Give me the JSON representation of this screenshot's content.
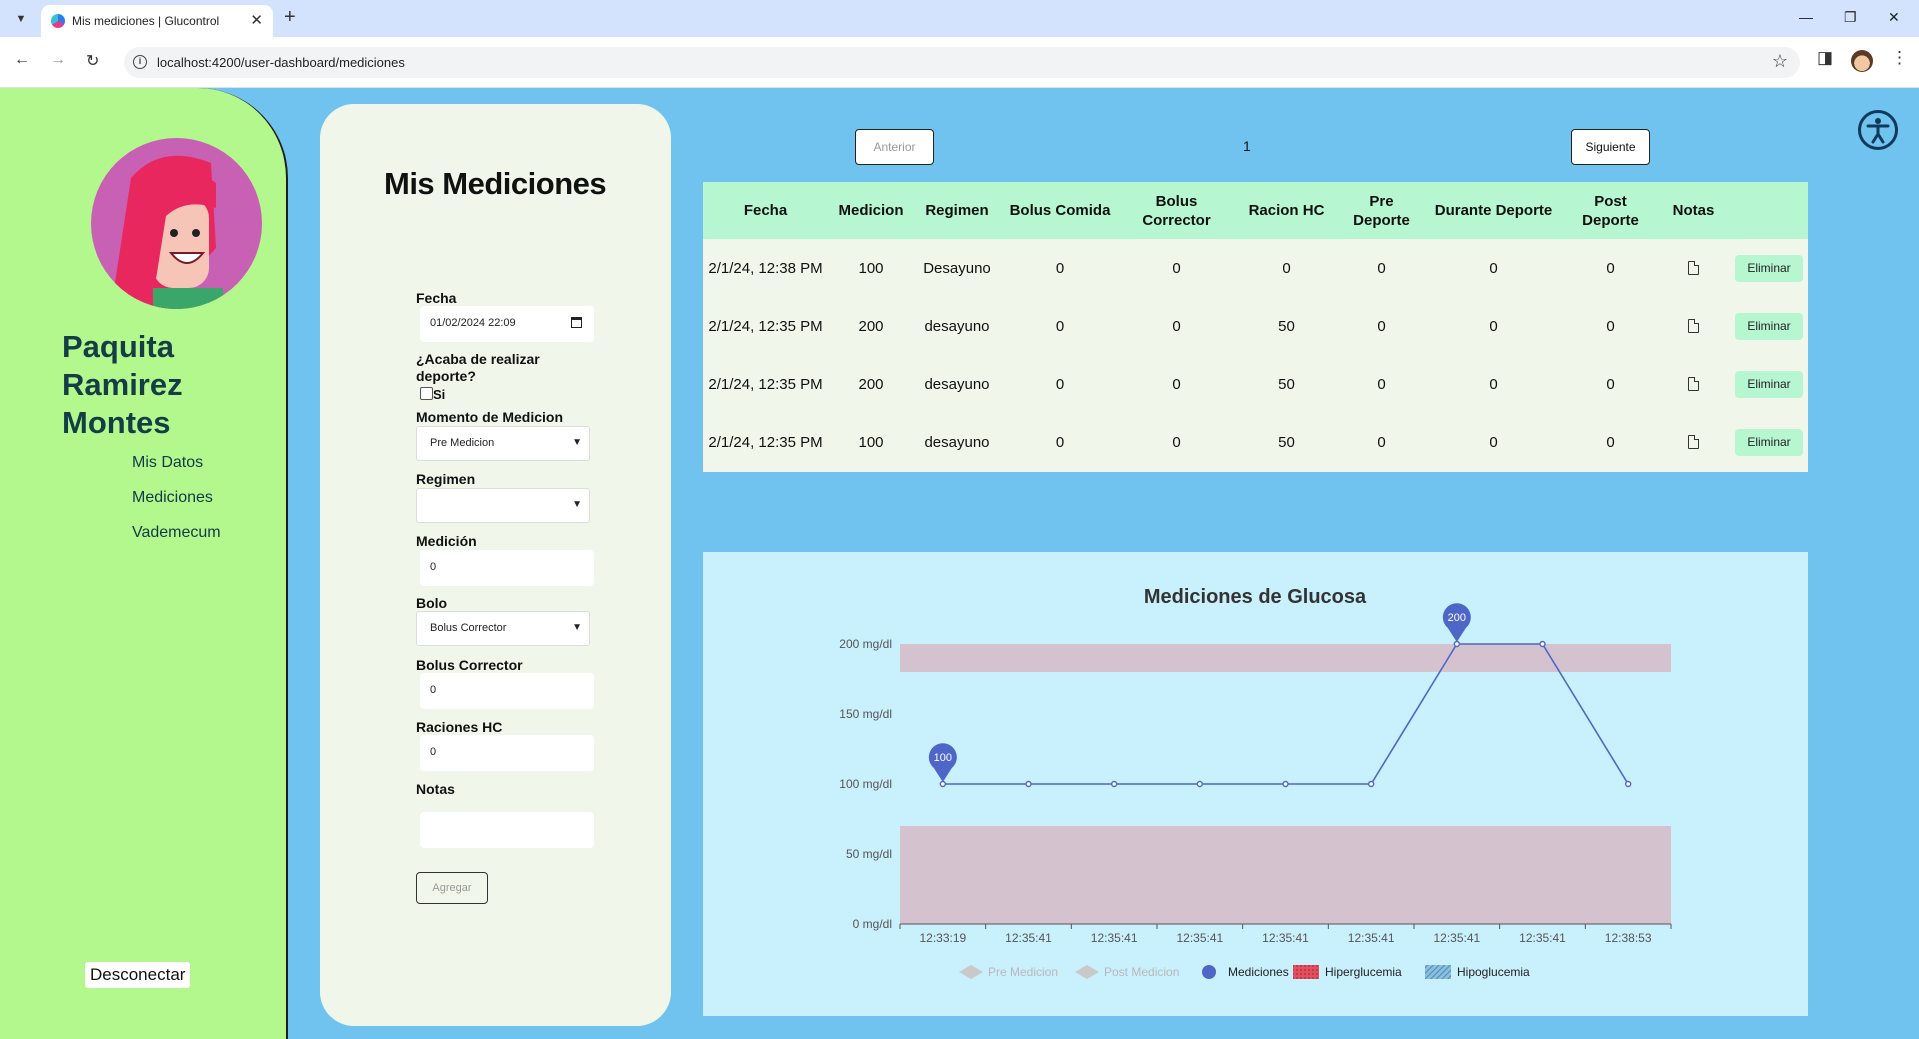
{
  "browser": {
    "tab_title": "Mis mediciones | Glucontrol",
    "url": "localhost:4200/user-dashboard/mediciones"
  },
  "sidebar": {
    "name": "Paquita Ramirez Montes",
    "links": [
      "Mis Datos",
      "Mediciones",
      "Vademecum"
    ],
    "logout_label": "Desconectar"
  },
  "form": {
    "title": "Mis Mediciones",
    "fecha_label": "Fecha",
    "fecha_value": "01/02/2024 22:09",
    "sport_question": "¿Acaba de realizar deporte?",
    "sport_option": "Si",
    "momento_label": "Momento de Medicion",
    "momento_value": "Pre Medicion",
    "regimen_label": "Regimen",
    "regimen_value": "",
    "medicion_label": "Medición",
    "medicion_value": "0",
    "bolo_label": "Bolo",
    "bolo_value": "Bolus Corrector",
    "bolus_corrector_label": "Bolus Corrector",
    "bolus_corrector_value": "0",
    "raciones_label": "Raciones HC",
    "raciones_value": "0",
    "notas_label": "Notas",
    "notas_value": "",
    "submit_label": "Agregar"
  },
  "pagination": {
    "prev_label": "Anterior",
    "page": "1",
    "next_label": "Siguiente"
  },
  "table": {
    "columns": [
      "Fecha",
      "Medicion",
      "Regimen",
      "Bolus Comida",
      "Bolus Corrector",
      "Racion HC",
      "Pre Deporte",
      "Durante Deporte",
      "Post Deporte",
      "Notas",
      ""
    ],
    "delete_label": "Eliminar",
    "rows": [
      {
        "fecha": "2/1/24, 12:38 PM",
        "medicion": "100",
        "regimen": "Desayuno",
        "bolus_comida": "0",
        "bolus_corrector": "0",
        "racion_hc": "0",
        "pre": "0",
        "durante": "0",
        "post": "0",
        "nota_icon": "file-x-icon"
      },
      {
        "fecha": "2/1/24, 12:35 PM",
        "medicion": "200",
        "regimen": "desayuno",
        "bolus_comida": "0",
        "bolus_corrector": "0",
        "racion_hc": "50",
        "pre": "0",
        "durante": "0",
        "post": "0",
        "nota_icon": "file-icon"
      },
      {
        "fecha": "2/1/24, 12:35 PM",
        "medicion": "200",
        "regimen": "desayuno",
        "bolus_comida": "0",
        "bolus_corrector": "0",
        "racion_hc": "50",
        "pre": "0",
        "durante": "0",
        "post": "0",
        "nota_icon": "file-icon"
      },
      {
        "fecha": "2/1/24, 12:35 PM",
        "medicion": "100",
        "regimen": "desayuno",
        "bolus_comida": "0",
        "bolus_corrector": "0",
        "racion_hc": "50",
        "pre": "0",
        "durante": "0",
        "post": "0",
        "nota_icon": "file-icon"
      }
    ]
  },
  "chart_data": {
    "type": "line",
    "title": "Mediciones de Glucosa",
    "x": [
      "12:33:19",
      "12:35:41",
      "12:35:41",
      "12:35:41",
      "12:35:41",
      "12:35:41",
      "12:35:41",
      "12:35:41",
      "12:38:53"
    ],
    "series": [
      {
        "name": "Mediciones",
        "values": [
          100,
          100,
          100,
          100,
          100,
          100,
          200,
          200,
          100
        ],
        "color": "#4e66c8"
      }
    ],
    "bands": [
      {
        "name": "Hiperglucemia",
        "from": 180,
        "to": 200
      },
      {
        "name": "Hipoglucemia",
        "from": 0,
        "to": 70
      }
    ],
    "markers": [
      {
        "index": 0,
        "label": "100"
      },
      {
        "index": 6,
        "label": "200"
      }
    ],
    "yticks": [
      "0 mg/dl",
      "50 mg/dl",
      "100 mg/dl",
      "150 mg/dl",
      "200 mg/dl"
    ],
    "ylim": [
      0,
      200
    ],
    "legend": [
      "Pre Medicion",
      "Post Medicion",
      "Mediciones",
      "Hiperglucemia",
      "Hipoglucemia"
    ],
    "legend_position": "bottom",
    "band_color": "#d4c2cf"
  },
  "icons": {
    "accessibility": "accessibility-icon",
    "avatar": "user-avatar"
  }
}
